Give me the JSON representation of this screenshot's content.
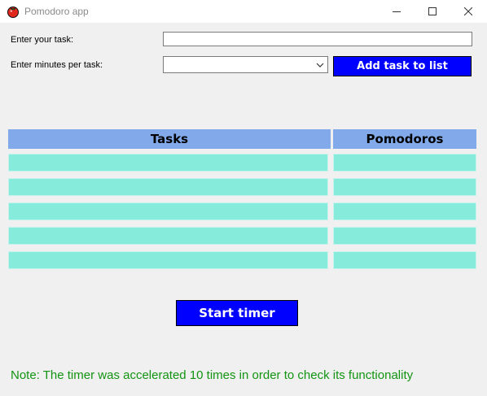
{
  "window": {
    "title": "Pomodoro app",
    "app_icon": "tomato-icon",
    "controls": [
      "minimize-icon",
      "maximize-icon",
      "close-icon"
    ]
  },
  "form": {
    "task_label": "Enter your task:",
    "task_value": "",
    "minutes_label": "Enter minutes per task:",
    "minutes_value": "",
    "add_button_label": "Add task to list"
  },
  "table": {
    "columns": [
      "Tasks",
      "Pomodoros"
    ],
    "rows": [
      {
        "task": "",
        "pomodoros": ""
      },
      {
        "task": "",
        "pomodoros": ""
      },
      {
        "task": "",
        "pomodoros": ""
      },
      {
        "task": "",
        "pomodoros": ""
      },
      {
        "task": "",
        "pomodoros": ""
      }
    ]
  },
  "start_button_label": "Start timer",
  "note": "Note: The timer was accelerated 10 times in order to check its functionality",
  "colors": {
    "button_bg": "#0000ff",
    "header_bg": "#82aaea",
    "cell_bg": "#87ebdb",
    "note_text": "#129412"
  }
}
